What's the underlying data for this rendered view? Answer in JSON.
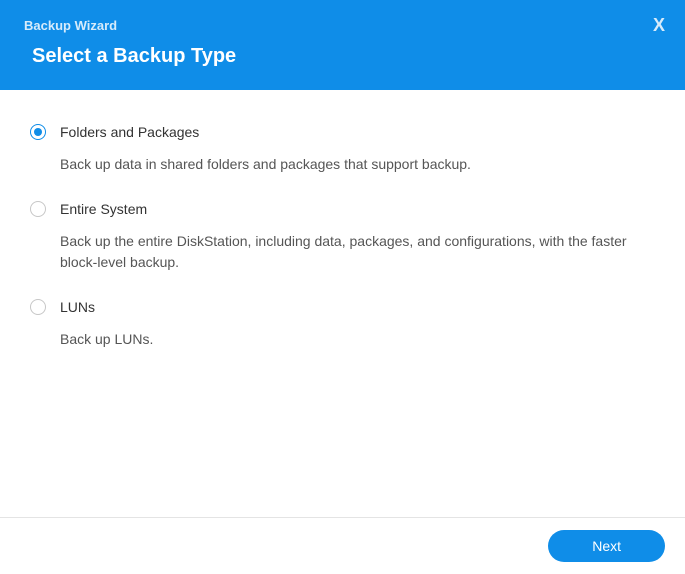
{
  "header": {
    "wizard_title": "Backup Wizard",
    "page_title": "Select a Backup Type",
    "close_label": "X"
  },
  "options": {
    "folders": {
      "label": "Folders and Packages",
      "desc": "Back up data in shared folders and packages that support backup.",
      "selected": true
    },
    "system": {
      "label": "Entire System",
      "desc": "Back up the entire DiskStation, including data, packages, and configurations, with the faster block-level backup.",
      "selected": false
    },
    "luns": {
      "label": "LUNs",
      "desc": "Back up LUNs.",
      "selected": false
    }
  },
  "footer": {
    "next_label": "Next"
  },
  "colors": {
    "accent": "#0F8DE8"
  }
}
